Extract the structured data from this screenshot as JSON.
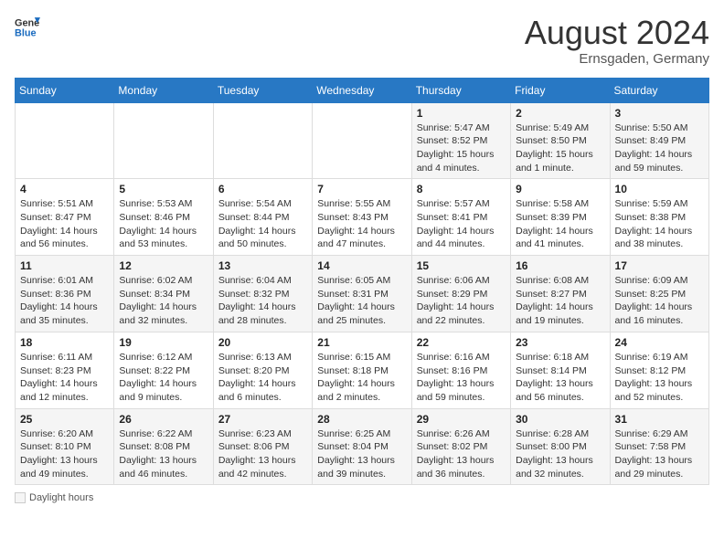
{
  "header": {
    "logo_general": "General",
    "logo_blue": "Blue",
    "month_year": "August 2024",
    "location": "Ernsgaden, Germany"
  },
  "footer": {
    "daylight_label": "Daylight hours"
  },
  "calendar": {
    "days_of_week": [
      "Sunday",
      "Monday",
      "Tuesday",
      "Wednesday",
      "Thursday",
      "Friday",
      "Saturday"
    ],
    "weeks": [
      [
        {
          "day": "",
          "info": ""
        },
        {
          "day": "",
          "info": ""
        },
        {
          "day": "",
          "info": ""
        },
        {
          "day": "",
          "info": ""
        },
        {
          "day": "1",
          "info": "Sunrise: 5:47 AM\nSunset: 8:52 PM\nDaylight: 15 hours and 4 minutes."
        },
        {
          "day": "2",
          "info": "Sunrise: 5:49 AM\nSunset: 8:50 PM\nDaylight: 15 hours and 1 minute."
        },
        {
          "day": "3",
          "info": "Sunrise: 5:50 AM\nSunset: 8:49 PM\nDaylight: 14 hours and 59 minutes."
        }
      ],
      [
        {
          "day": "4",
          "info": "Sunrise: 5:51 AM\nSunset: 8:47 PM\nDaylight: 14 hours and 56 minutes."
        },
        {
          "day": "5",
          "info": "Sunrise: 5:53 AM\nSunset: 8:46 PM\nDaylight: 14 hours and 53 minutes."
        },
        {
          "day": "6",
          "info": "Sunrise: 5:54 AM\nSunset: 8:44 PM\nDaylight: 14 hours and 50 minutes."
        },
        {
          "day": "7",
          "info": "Sunrise: 5:55 AM\nSunset: 8:43 PM\nDaylight: 14 hours and 47 minutes."
        },
        {
          "day": "8",
          "info": "Sunrise: 5:57 AM\nSunset: 8:41 PM\nDaylight: 14 hours and 44 minutes."
        },
        {
          "day": "9",
          "info": "Sunrise: 5:58 AM\nSunset: 8:39 PM\nDaylight: 14 hours and 41 minutes."
        },
        {
          "day": "10",
          "info": "Sunrise: 5:59 AM\nSunset: 8:38 PM\nDaylight: 14 hours and 38 minutes."
        }
      ],
      [
        {
          "day": "11",
          "info": "Sunrise: 6:01 AM\nSunset: 8:36 PM\nDaylight: 14 hours and 35 minutes."
        },
        {
          "day": "12",
          "info": "Sunrise: 6:02 AM\nSunset: 8:34 PM\nDaylight: 14 hours and 32 minutes."
        },
        {
          "day": "13",
          "info": "Sunrise: 6:04 AM\nSunset: 8:32 PM\nDaylight: 14 hours and 28 minutes."
        },
        {
          "day": "14",
          "info": "Sunrise: 6:05 AM\nSunset: 8:31 PM\nDaylight: 14 hours and 25 minutes."
        },
        {
          "day": "15",
          "info": "Sunrise: 6:06 AM\nSunset: 8:29 PM\nDaylight: 14 hours and 22 minutes."
        },
        {
          "day": "16",
          "info": "Sunrise: 6:08 AM\nSunset: 8:27 PM\nDaylight: 14 hours and 19 minutes."
        },
        {
          "day": "17",
          "info": "Sunrise: 6:09 AM\nSunset: 8:25 PM\nDaylight: 14 hours and 16 minutes."
        }
      ],
      [
        {
          "day": "18",
          "info": "Sunrise: 6:11 AM\nSunset: 8:23 PM\nDaylight: 14 hours and 12 minutes."
        },
        {
          "day": "19",
          "info": "Sunrise: 6:12 AM\nSunset: 8:22 PM\nDaylight: 14 hours and 9 minutes."
        },
        {
          "day": "20",
          "info": "Sunrise: 6:13 AM\nSunset: 8:20 PM\nDaylight: 14 hours and 6 minutes."
        },
        {
          "day": "21",
          "info": "Sunrise: 6:15 AM\nSunset: 8:18 PM\nDaylight: 14 hours and 2 minutes."
        },
        {
          "day": "22",
          "info": "Sunrise: 6:16 AM\nSunset: 8:16 PM\nDaylight: 13 hours and 59 minutes."
        },
        {
          "day": "23",
          "info": "Sunrise: 6:18 AM\nSunset: 8:14 PM\nDaylight: 13 hours and 56 minutes."
        },
        {
          "day": "24",
          "info": "Sunrise: 6:19 AM\nSunset: 8:12 PM\nDaylight: 13 hours and 52 minutes."
        }
      ],
      [
        {
          "day": "25",
          "info": "Sunrise: 6:20 AM\nSunset: 8:10 PM\nDaylight: 13 hours and 49 minutes."
        },
        {
          "day": "26",
          "info": "Sunrise: 6:22 AM\nSunset: 8:08 PM\nDaylight: 13 hours and 46 minutes."
        },
        {
          "day": "27",
          "info": "Sunrise: 6:23 AM\nSunset: 8:06 PM\nDaylight: 13 hours and 42 minutes."
        },
        {
          "day": "28",
          "info": "Sunrise: 6:25 AM\nSunset: 8:04 PM\nDaylight: 13 hours and 39 minutes."
        },
        {
          "day": "29",
          "info": "Sunrise: 6:26 AM\nSunset: 8:02 PM\nDaylight: 13 hours and 36 minutes."
        },
        {
          "day": "30",
          "info": "Sunrise: 6:28 AM\nSunset: 8:00 PM\nDaylight: 13 hours and 32 minutes."
        },
        {
          "day": "31",
          "info": "Sunrise: 6:29 AM\nSunset: 7:58 PM\nDaylight: 13 hours and 29 minutes."
        }
      ]
    ]
  }
}
